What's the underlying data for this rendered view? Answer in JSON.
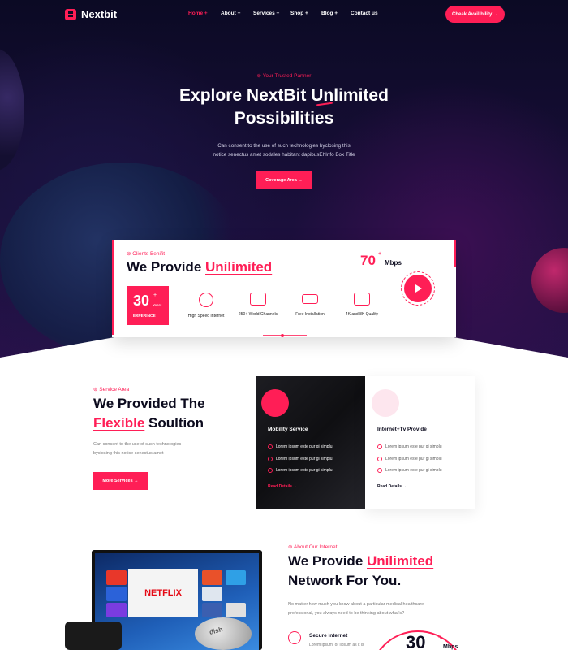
{
  "nav": {
    "brand": "Nextbit",
    "items": [
      {
        "label": "Home +",
        "active": true
      },
      {
        "label": "About +"
      },
      {
        "label": "Services +"
      },
      {
        "label": "Shop +"
      },
      {
        "label": "Blog +"
      },
      {
        "label": "Contact us"
      }
    ],
    "cta": "Cheak Availibility →"
  },
  "hero": {
    "tagline": "Your Trusted Partner",
    "title_line1": "Explore NextBit Unlimited",
    "title_line2": "Possibilities",
    "desc_line1": "Can consent to the use of such technologies byclosing this",
    "desc_line2": "notice senectus amet sodales habitant dapibusEhInfo Box Title",
    "button": "Coverage Area →"
  },
  "clients": {
    "tag": "Clients Benifit",
    "title_plain": "We Provide",
    "title_accent": "Unilimited",
    "speed_value": "70",
    "speed_plus": "+",
    "speed_unit": "Mbps",
    "years_value": "30",
    "years_plus": "+",
    "years_unit": "Years",
    "years_label": "EXPERINCE",
    "features": [
      {
        "icon": "speedometer-icon",
        "label": "HIgh Speed Internet"
      },
      {
        "icon": "tv-icon",
        "label": "250+ World Channels"
      },
      {
        "icon": "router-icon",
        "label": "Free Installation"
      },
      {
        "icon": "monitor-4k-icon",
        "label": "4K and 8K Quality"
      }
    ]
  },
  "services": {
    "tag": "Service Area",
    "title_line1": "We Provided The",
    "title_accent": "Flexible",
    "title_rest": "Soultion",
    "desc_line1": "Can consent to the use of such technologies",
    "desc_line2": "byclosing this notice senectus amet",
    "button": "More Services →",
    "cards": [
      {
        "title": "Mobility Service",
        "items": [
          "Lorem ipsum este pur gi simplu",
          "Lorem ipsum este pur gi simplu",
          "Lorem ipsum este pur gi simplu"
        ],
        "link": "Read Details →"
      },
      {
        "title": "Internet+Tv Provide",
        "items": [
          "Lorem ipsum este pur gi simplu",
          "Lorem ipsum este pur gi simplu",
          "Lorem ipsum este pur gi simplu"
        ],
        "link": "Read Details →"
      }
    ]
  },
  "about": {
    "tag": "About Our Internet",
    "title_plain": "We Provide",
    "title_accent": "Unilimited",
    "title_line2": "Network For You.",
    "desc_line1": "No matter how much you know about a particular medical healthcare",
    "desc_line2": "professional, you always need to be thinking about what's?",
    "secure_title": "Secure Internet",
    "secure_desc": "Lorem ipsum, or lipsum as it is",
    "stat_value": "30",
    "stat_plus": "+",
    "stat_unit": "Mbps",
    "tv_brand": "NETFLIX",
    "dish_text": "dish"
  },
  "colors": {
    "accent": "#ff1e56",
    "dark": "#0b0a24"
  }
}
